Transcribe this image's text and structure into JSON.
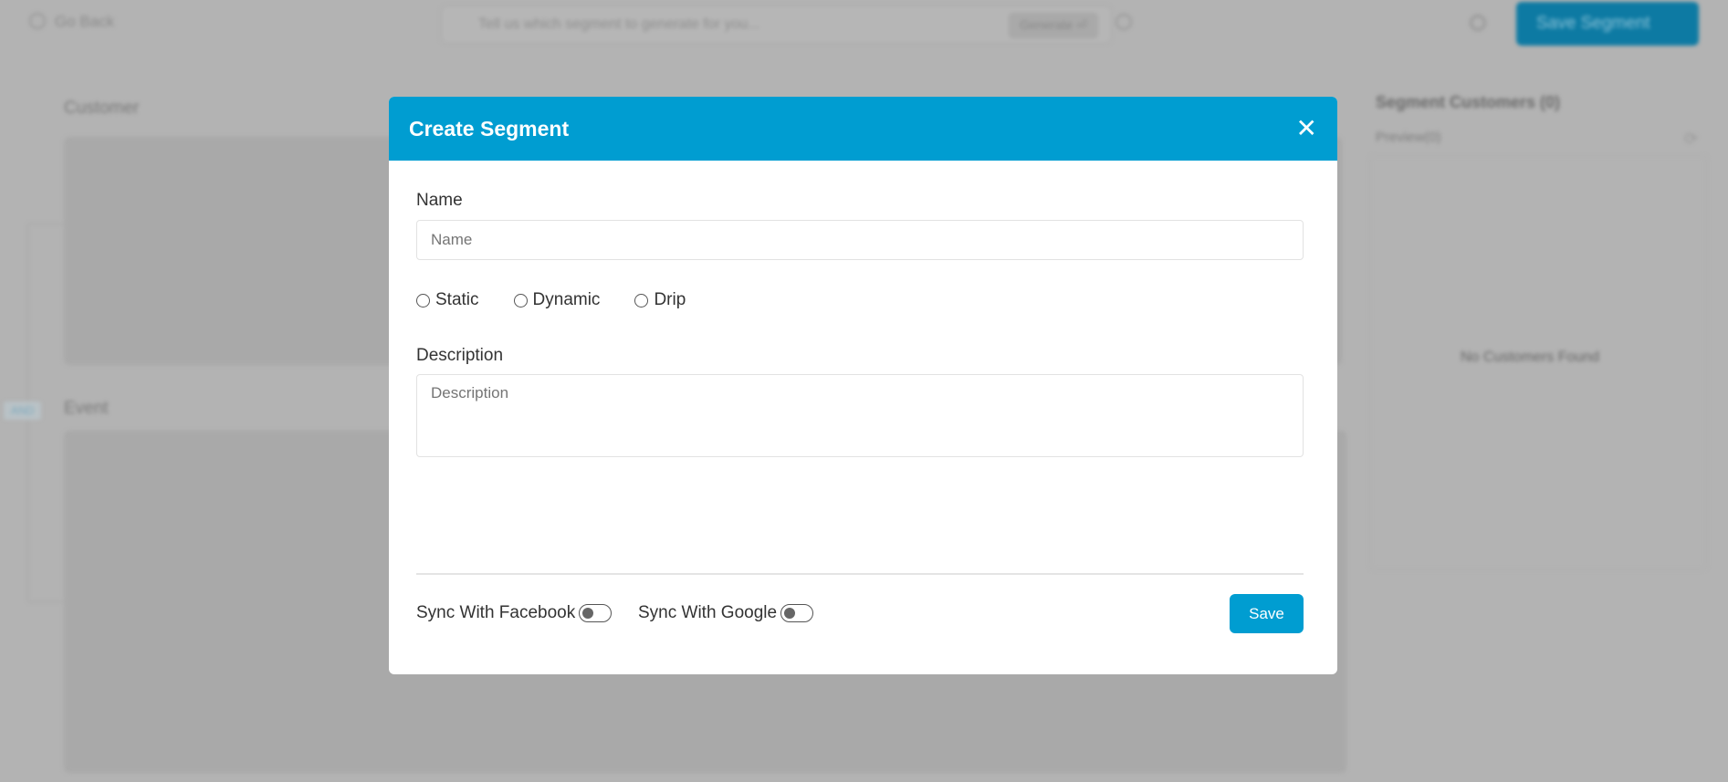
{
  "background": {
    "go_back": "Go Back",
    "search_placeholder": "Tell us which segment to generate for you...",
    "generate_label": "Generate ⏎",
    "save_segment_label": "Save Segment",
    "customer_heading": "Customer",
    "event_heading": "Event",
    "and_badge": "AND",
    "segment_customers_title": "Segment Customers (0)",
    "preview_label": "Preview(0)",
    "no_customers": "No Customers Found"
  },
  "modal": {
    "title": "Create Segment",
    "close_icon": "close-icon",
    "name_label": "Name",
    "name_placeholder": "Name",
    "name_value": "",
    "types": [
      "Static",
      "Dynamic",
      "Drip"
    ],
    "selected_type": null,
    "description_label": "Description",
    "description_placeholder": "Description",
    "description_value": "",
    "sync_facebook_label": "Sync With Facebook",
    "sync_facebook_on": false,
    "sync_google_label": "Sync With Google",
    "sync_google_on": false,
    "save_label": "Save"
  },
  "colors": {
    "accent": "#009dd1"
  }
}
